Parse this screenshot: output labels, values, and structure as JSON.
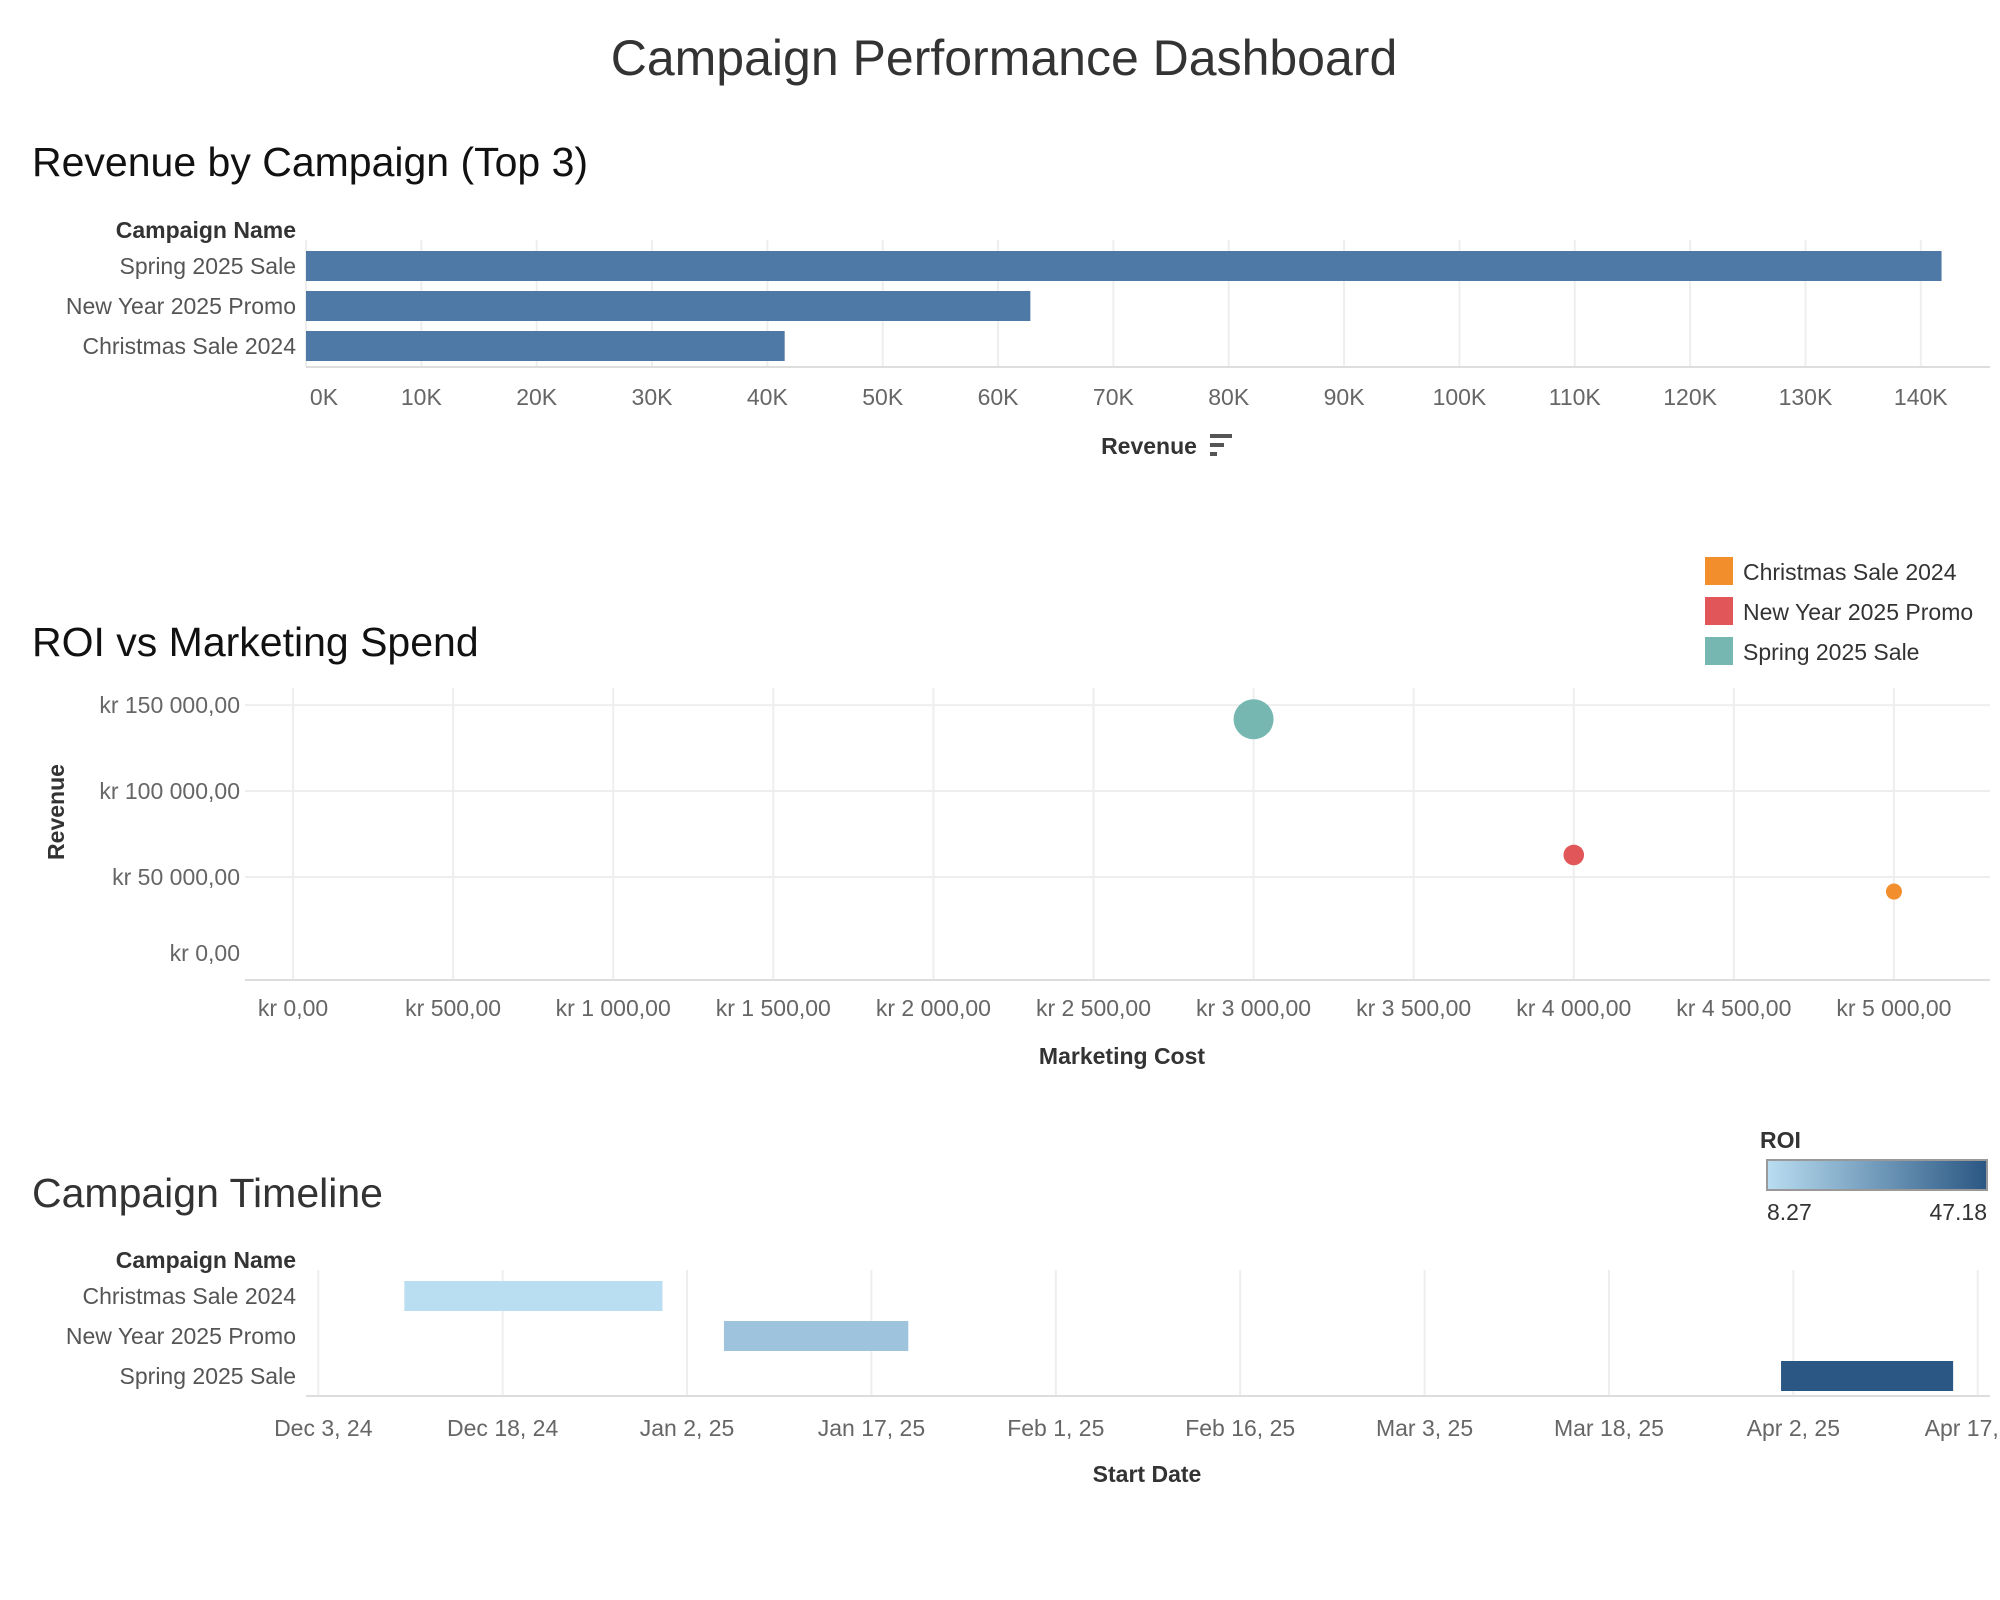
{
  "dashboard": {
    "title": "Campaign Performance Dashboard"
  },
  "chart_data": [
    {
      "id": "revenue_by_campaign",
      "type": "bar",
      "orientation": "horizontal",
      "title": "Revenue by Campaign (Top 3)",
      "row_header": "Campaign Name",
      "xlabel": "Revenue",
      "sort_icon": "sort-descending-icon",
      "categories": [
        "Spring 2025 Sale",
        "New Year 2025 Promo",
        "Christmas Sale 2024"
      ],
      "values": [
        141800,
        62800,
        41500
      ],
      "xlim": [
        0,
        146000
      ],
      "xticks": [
        0,
        10000,
        20000,
        30000,
        40000,
        50000,
        60000,
        70000,
        80000,
        90000,
        100000,
        110000,
        120000,
        130000,
        140000
      ],
      "xtick_labels": [
        "0K",
        "10K",
        "20K",
        "30K",
        "40K",
        "50K",
        "60K",
        "70K",
        "80K",
        "90K",
        "100K",
        "110K",
        "120K",
        "130K",
        "140K"
      ],
      "bar_color": "#4e79a7",
      "grid": true
    },
    {
      "id": "roi_vs_spend",
      "type": "scatter",
      "title": "ROI vs Marketing Spend",
      "xlabel": "Marketing Cost",
      "ylabel": "Revenue",
      "xlim": [
        -150,
        5300
      ],
      "ylim": [
        -10000,
        160000
      ],
      "xticks": [
        0,
        500,
        1000,
        1500,
        2000,
        2500,
        3000,
        3500,
        4000,
        4500,
        5000
      ],
      "xtick_labels": [
        "kr 0,00",
        "kr 500,00",
        "kr 1 000,00",
        "kr 1 500,00",
        "kr 2 000,00",
        "kr 2 500,00",
        "kr 3 000,00",
        "kr 3 500,00",
        "kr 4 000,00",
        "kr 4 500,00",
        "kr 5 000,00"
      ],
      "yticks": [
        0,
        50000,
        100000,
        150000
      ],
      "ytick_labels": [
        "kr 0,00",
        "kr 50 000,00",
        "kr 100 000,00",
        "kr 150 000,00"
      ],
      "legend": {
        "placement": "top-right",
        "items": [
          {
            "name": "Christmas Sale 2024",
            "color": "#f28e2b"
          },
          {
            "name": "New Year 2025 Promo",
            "color": "#e15759"
          },
          {
            "name": "Spring 2025 Sale",
            "color": "#76b7b2"
          }
        ]
      },
      "series": [
        {
          "name": "Christmas Sale 2024",
          "x": 5000,
          "y": 41500,
          "roi": 8.27,
          "color": "#f28e2b"
        },
        {
          "name": "New Year 2025 Promo",
          "x": 4000,
          "y": 62800,
          "roi": 15.7,
          "color": "#e15759"
        },
        {
          "name": "Spring 2025 Sale",
          "x": 3000,
          "y": 141800,
          "roi": 47.18,
          "color": "#76b7b2"
        }
      ],
      "size_encodes": "ROI",
      "grid": true
    },
    {
      "id": "campaign_timeline",
      "type": "gantt",
      "title": "Campaign Timeline",
      "row_header": "Campaign Name",
      "xlabel": "Start Date",
      "xlim": [
        "2024-12-02",
        "2025-04-18"
      ],
      "xticks": [
        "2024-12-03",
        "2024-12-18",
        "2025-01-02",
        "2025-01-17",
        "2025-02-01",
        "2025-02-16",
        "2025-03-03",
        "2025-03-18",
        "2025-04-02",
        "2025-04-17"
      ],
      "xtick_labels": [
        "Dec 3, 24",
        "Dec 18, 24",
        "Jan 2, 25",
        "Jan 17, 25",
        "Feb 1, 25",
        "Feb 16, 25",
        "Mar 3, 25",
        "Mar 18, 25",
        "Apr 2, 25",
        "Apr 17, 25"
      ],
      "tasks": [
        {
          "name": "Christmas Sale 2024",
          "start": "2024-12-10",
          "end": "2024-12-31",
          "roi": 8.27
        },
        {
          "name": "New Year 2025 Promo",
          "start": "2025-01-05",
          "end": "2025-01-20",
          "roi": 15.7
        },
        {
          "name": "Spring 2025 Sale",
          "start": "2025-04-01",
          "end": "2025-04-15",
          "roi": 47.18
        }
      ],
      "color_legend": {
        "title": "ROI",
        "min": 8.27,
        "max": 47.18,
        "min_label": "8.27",
        "max_label": "47.18",
        "low_color": "#b9ddf1",
        "high_color": "#2a5783"
      },
      "grid": true
    }
  ]
}
